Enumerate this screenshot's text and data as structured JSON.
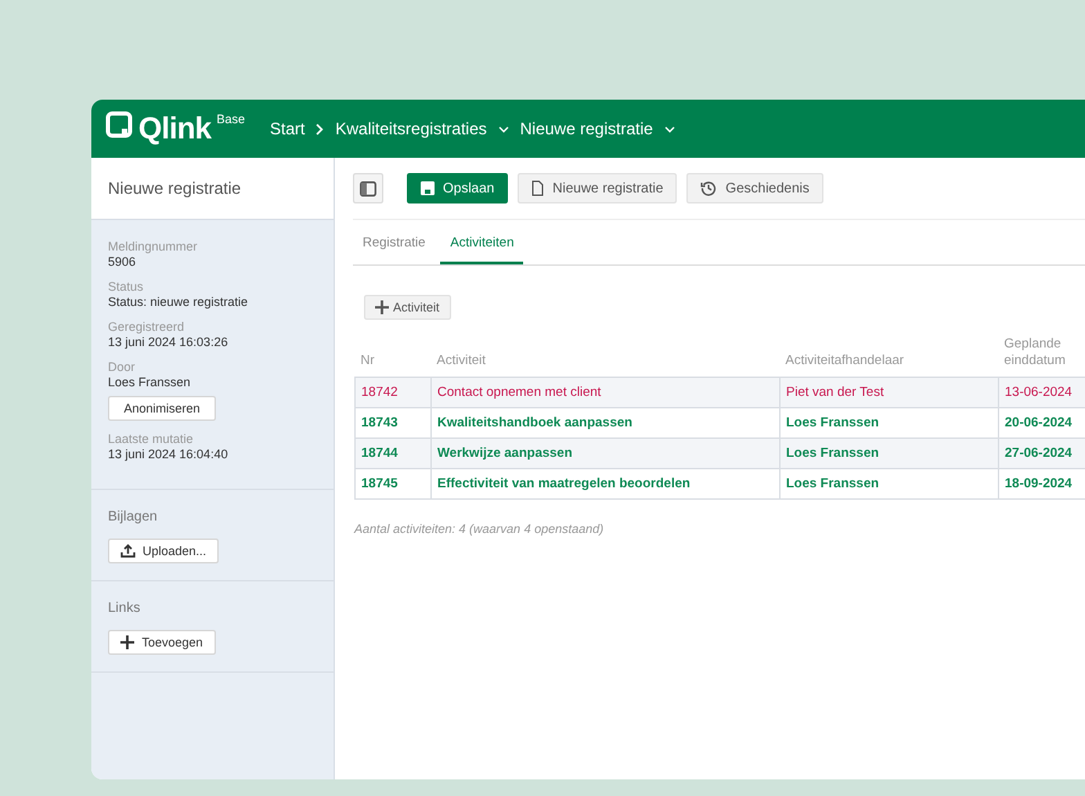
{
  "header": {
    "logo": "Qlink",
    "logo_sup": "Base",
    "breadcrumbs": [
      {
        "label": "Start",
        "dropdown": false
      },
      {
        "label": "Kwaliteitsregistraties",
        "dropdown": true
      },
      {
        "label": "Nieuwe registratie",
        "dropdown": true
      }
    ]
  },
  "sidebar": {
    "title": "Nieuwe registratie",
    "fields": [
      {
        "label": "Meldingnummer",
        "value": "5906"
      },
      {
        "label": "Status",
        "value": "Status: nieuwe registratie"
      },
      {
        "label": "Geregistreerd",
        "value": "13 juni 2024 16:03:26"
      },
      {
        "label": "Door",
        "value": "Loes Franssen",
        "button": "Anonimiseren"
      },
      {
        "label": "Laatste mutatie",
        "value": "13 juni 2024 16:04:40"
      }
    ],
    "sections": [
      {
        "title": "Bijlagen",
        "button": "Uploaden...",
        "kind": "upload"
      },
      {
        "title": "Links",
        "button": "Toevoegen",
        "kind": "add"
      }
    ]
  },
  "toolbar": {
    "buttons": [
      {
        "label": "Opslaan",
        "kind": "save",
        "primary": true
      },
      {
        "label": "Nieuwe registratie",
        "kind": "new",
        "primary": false
      },
      {
        "label": "Geschiedenis",
        "kind": "history",
        "primary": false
      }
    ]
  },
  "tabs": [
    {
      "label": "Registratie",
      "selected": false
    },
    {
      "label": "Activiteiten",
      "selected": true
    }
  ],
  "add_button": "Activiteit",
  "table": {
    "columns": [
      "Nr",
      "Activiteit",
      "Activiteitafhandelaar",
      "Geplande einddatum"
    ],
    "rows": [
      {
        "cells": [
          "18742",
          "Contact opnemen met client",
          "Piet van der Test",
          "13-06-2024"
        ],
        "overdue": true
      },
      {
        "cells": [
          "18743",
          "Kwaliteitshandboek aanpassen",
          "Loes Franssen",
          "20-06-2024"
        ],
        "overdue": false
      },
      {
        "cells": [
          "18744",
          "Werkwijze aanpassen",
          "Loes Franssen",
          "27-06-2024"
        ],
        "overdue": false
      },
      {
        "cells": [
          "18745",
          "Effectiviteit van maatregelen beoordelen",
          "Loes Franssen",
          "18-09-2024"
        ],
        "overdue": false
      }
    ]
  },
  "summary": "Aantal activiteiten: 4 (waarvan 4 openstaand)"
}
